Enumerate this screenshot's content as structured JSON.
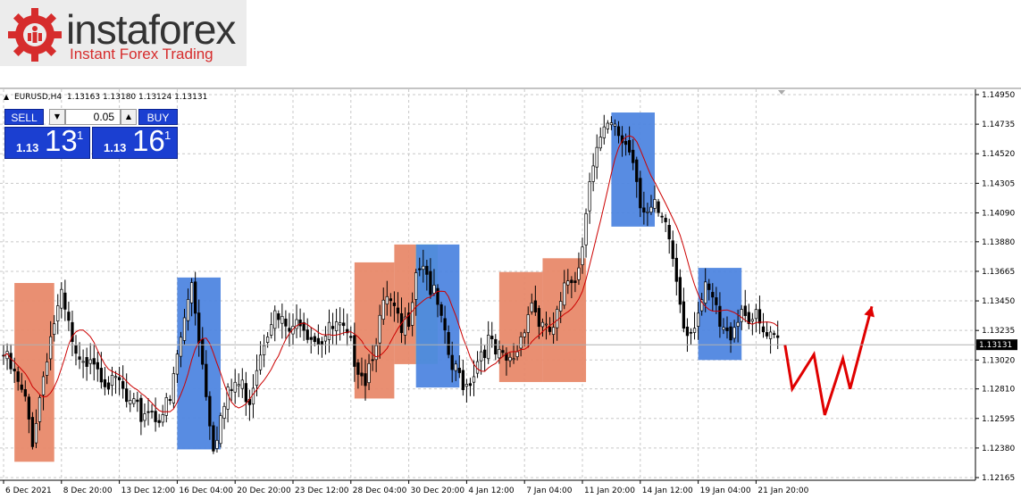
{
  "logo": {
    "brand": "instaforex",
    "tagline": "Instant Forex Trading"
  },
  "header": {
    "symbol": "EURUSD,H4",
    "quote": "1.13163 1.13180 1.13124 1.13131"
  },
  "trade_panel": {
    "sell_label": "SELL",
    "buy_label": "BUY",
    "lot_value": "0.05",
    "sell_price_small": "1.13",
    "sell_price_big": "13",
    "sell_price_sup": "1",
    "buy_price_small": "1.13",
    "buy_price_big": "16",
    "buy_price_sup": "1"
  },
  "colors": {
    "up_candle": "#000000",
    "down_candle": "#000000",
    "moving_average": "#cc0000",
    "forecast": "#e00000",
    "box_orange": "#e8896a",
    "box_blue": "#4f86e0",
    "box_green": "#66ee66"
  },
  "chart_data": {
    "type": "candlestick",
    "symbol": "EURUSD",
    "timeframe": "H4",
    "current_price": "1.13131",
    "ylim": [
      1.1212,
      1.15
    ],
    "y_ticks": [
      "1.14950",
      "1.14735",
      "1.14520",
      "1.14305",
      "1.14090",
      "1.13880",
      "1.13665",
      "1.13450",
      "1.13235",
      "1.13020",
      "1.12810",
      "1.12595",
      "1.12380",
      "1.12165"
    ],
    "x_ticks": [
      "6 Dec 2021",
      "8 Dec 20:00",
      "13 Dec 12:00",
      "16 Dec 04:00",
      "20 Dec 20:00",
      "23 Dec 12:00",
      "28 Dec 04:00",
      "30 Dec 20:00",
      "4 Jan 12:00",
      "7 Jan 04:00",
      "11 Jan 20:00",
      "14 Jan 12:00",
      "19 Jan 04:00",
      "21 Jan 20:00"
    ],
    "x_tick_bar_index": [
      0,
      16,
      32,
      48,
      64,
      80,
      96,
      112,
      128,
      144,
      160,
      176,
      192,
      208
    ],
    "price_path": [
      {
        "bar": 0,
        "price": 1.1305
      },
      {
        "bar": 2,
        "price": 1.1295
      },
      {
        "bar": 4,
        "price": 1.1283
      },
      {
        "bar": 6,
        "price": 1.127
      },
      {
        "bar": 8,
        "price": 1.1245
      },
      {
        "bar": 10,
        "price": 1.1275
      },
      {
        "bar": 12,
        "price": 1.1308
      },
      {
        "bar": 14,
        "price": 1.133
      },
      {
        "bar": 16,
        "price": 1.1345
      },
      {
        "bar": 18,
        "price": 1.1325
      },
      {
        "bar": 20,
        "price": 1.13
      },
      {
        "bar": 22,
        "price": 1.1295
      },
      {
        "bar": 24,
        "price": 1.131
      },
      {
        "bar": 26,
        "price": 1.13
      },
      {
        "bar": 28,
        "price": 1.129
      },
      {
        "bar": 30,
        "price": 1.1282
      },
      {
        "bar": 32,
        "price": 1.1285
      },
      {
        "bar": 34,
        "price": 1.127
      },
      {
        "bar": 36,
        "price": 1.1265
      },
      {
        "bar": 38,
        "price": 1.1262
      },
      {
        "bar": 40,
        "price": 1.1268
      },
      {
        "bar": 42,
        "price": 1.1262
      },
      {
        "bar": 44,
        "price": 1.1265
      },
      {
        "bar": 46,
        "price": 1.127
      },
      {
        "bar": 48,
        "price": 1.1305
      },
      {
        "bar": 50,
        "price": 1.133
      },
      {
        "bar": 52,
        "price": 1.136
      },
      {
        "bar": 54,
        "price": 1.132
      },
      {
        "bar": 56,
        "price": 1.128
      },
      {
        "bar": 58,
        "price": 1.1242
      },
      {
        "bar": 60,
        "price": 1.126
      },
      {
        "bar": 62,
        "price": 1.1275
      },
      {
        "bar": 64,
        "price": 1.1285
      },
      {
        "bar": 66,
        "price": 1.1282
      },
      {
        "bar": 68,
        "price": 1.1275
      },
      {
        "bar": 70,
        "price": 1.13
      },
      {
        "bar": 72,
        "price": 1.132
      },
      {
        "bar": 74,
        "price": 1.1335
      },
      {
        "bar": 76,
        "price": 1.133
      },
      {
        "bar": 78,
        "price": 1.1325
      },
      {
        "bar": 80,
        "price": 1.132
      },
      {
        "bar": 82,
        "price": 1.1335
      },
      {
        "bar": 84,
        "price": 1.1325
      },
      {
        "bar": 86,
        "price": 1.132
      },
      {
        "bar": 88,
        "price": 1.1318
      },
      {
        "bar": 90,
        "price": 1.1322
      },
      {
        "bar": 92,
        "price": 1.1325
      },
      {
        "bar": 94,
        "price": 1.132
      },
      {
        "bar": 96,
        "price": 1.131
      },
      {
        "bar": 98,
        "price": 1.13
      },
      {
        "bar": 100,
        "price": 1.129
      },
      {
        "bar": 102,
        "price": 1.131
      },
      {
        "bar": 104,
        "price": 1.133
      },
      {
        "bar": 106,
        "price": 1.1345
      },
      {
        "bar": 108,
        "price": 1.1335
      },
      {
        "bar": 110,
        "price": 1.132
      },
      {
        "bar": 112,
        "price": 1.1335
      },
      {
        "bar": 114,
        "price": 1.137
      },
      {
        "bar": 116,
        "price": 1.1375
      },
      {
        "bar": 118,
        "price": 1.1355
      },
      {
        "bar": 120,
        "price": 1.134
      },
      {
        "bar": 122,
        "price": 1.1315
      },
      {
        "bar": 124,
        "price": 1.1295
      },
      {
        "bar": 126,
        "price": 1.129
      },
      {
        "bar": 128,
        "price": 1.1285
      },
      {
        "bar": 130,
        "price": 1.1295
      },
      {
        "bar": 132,
        "price": 1.131
      },
      {
        "bar": 134,
        "price": 1.1315
      },
      {
        "bar": 136,
        "price": 1.1305
      },
      {
        "bar": 138,
        "price": 1.13
      },
      {
        "bar": 140,
        "price": 1.13
      },
      {
        "bar": 142,
        "price": 1.131
      },
      {
        "bar": 144,
        "price": 1.133
      },
      {
        "bar": 146,
        "price": 1.1345
      },
      {
        "bar": 148,
        "price": 1.133
      },
      {
        "bar": 150,
        "price": 1.132
      },
      {
        "bar": 152,
        "price": 1.1325
      },
      {
        "bar": 154,
        "price": 1.134
      },
      {
        "bar": 156,
        "price": 1.136
      },
      {
        "bar": 158,
        "price": 1.1365
      },
      {
        "bar": 160,
        "price": 1.1385
      },
      {
        "bar": 162,
        "price": 1.144
      },
      {
        "bar": 164,
        "price": 1.1455
      },
      {
        "bar": 166,
        "price": 1.1465
      },
      {
        "bar": 168,
        "price": 1.147
      },
      {
        "bar": 170,
        "price": 1.1465
      },
      {
        "bar": 172,
        "price": 1.146
      },
      {
        "bar": 174,
        "price": 1.145
      },
      {
        "bar": 176,
        "price": 1.142
      },
      {
        "bar": 178,
        "price": 1.141
      },
      {
        "bar": 180,
        "price": 1.141
      },
      {
        "bar": 182,
        "price": 1.14
      },
      {
        "bar": 184,
        "price": 1.139
      },
      {
        "bar": 186,
        "price": 1.136
      },
      {
        "bar": 188,
        "price": 1.133
      },
      {
        "bar": 190,
        "price": 1.1325
      },
      {
        "bar": 192,
        "price": 1.134
      },
      {
        "bar": 194,
        "price": 1.135
      },
      {
        "bar": 196,
        "price": 1.1345
      },
      {
        "bar": 198,
        "price": 1.1325
      },
      {
        "bar": 200,
        "price": 1.1318
      },
      {
        "bar": 202,
        "price": 1.133
      },
      {
        "bar": 204,
        "price": 1.134
      },
      {
        "bar": 206,
        "price": 1.1335
      },
      {
        "bar": 208,
        "price": 1.133
      },
      {
        "bar": 210,
        "price": 1.132
      },
      {
        "bar": 212,
        "price": 1.1315
      },
      {
        "bar": 214,
        "price": 1.1313
      }
    ],
    "highlight_boxes": [
      {
        "color": "orange",
        "bar_start": 3,
        "bar_end": 14,
        "price_low": 1.1228,
        "price_high": 1.1358
      },
      {
        "color": "blue",
        "bar_start": 48,
        "bar_end": 60,
        "price_low": 1.1237,
        "price_high": 1.1362
      },
      {
        "color": "orange",
        "bar_start": 97,
        "bar_end": 108,
        "price_low": 1.1274,
        "price_high": 1.1373
      },
      {
        "color": "orange",
        "bar_start": 108,
        "bar_end": 114,
        "price_low": 1.1299,
        "price_high": 1.1386
      },
      {
        "color": "green",
        "bar_start": 114,
        "bar_end": 120,
        "price_low": 1.1299,
        "price_high": 1.1386
      },
      {
        "color": "blue",
        "bar_start": 114,
        "bar_end": 126,
        "price_low": 1.1282,
        "price_high": 1.1386
      },
      {
        "color": "orange",
        "bar_start": 137,
        "bar_end": 149,
        "price_low": 1.1286,
        "price_high": 1.1366
      },
      {
        "color": "orange",
        "bar_start": 149,
        "bar_end": 161,
        "price_low": 1.1286,
        "price_high": 1.1376
      },
      {
        "color": "blue",
        "bar_start": 168,
        "bar_end": 180,
        "price_low": 1.1399,
        "price_high": 1.1482
      },
      {
        "color": "blue",
        "bar_start": 192,
        "bar_end": 204,
        "price_low": 1.1302,
        "price_high": 1.1369
      }
    ],
    "forecast_path": [
      {
        "bar": 216,
        "price": 1.1313
      },
      {
        "bar": 218,
        "price": 1.1281
      },
      {
        "bar": 224,
        "price": 1.1306
      },
      {
        "bar": 227,
        "price": 1.1262
      },
      {
        "bar": 232,
        "price": 1.1303
      },
      {
        "bar": 234,
        "price": 1.1281
      },
      {
        "bar": 240,
        "price": 1.1341
      }
    ],
    "grid": true,
    "legend": "none"
  }
}
